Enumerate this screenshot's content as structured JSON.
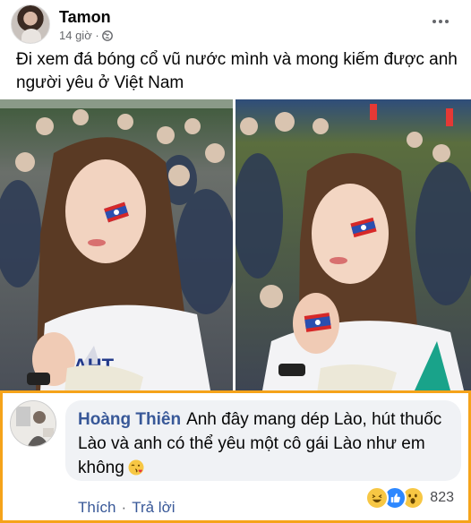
{
  "post": {
    "author": "Tamon",
    "time": "14 giờ ·",
    "privacy_icon": "globe-icon",
    "caption": "Đi xem đá bóng cổ vũ nước mình và mong kiếm được anh người yêu ở Việt Nam"
  },
  "comment": {
    "name": "Hoàng Thiên",
    "text": "Anh đây mang dép Lào, hút thuốc Lào và anh có thể yêu một cô gái Lào như em không",
    "emoji": "face-blowing-kiss-icon",
    "actions": {
      "like": "Thích",
      "separator": "·",
      "reply": "Trả lời"
    },
    "reactions": {
      "types": [
        "haha-icon",
        "like-icon",
        "wow-icon"
      ],
      "count": "823"
    }
  },
  "colors": {
    "highlight_border": "#f5a31a",
    "link_blue": "#385898",
    "bubble_bg": "#f0f2f5"
  }
}
